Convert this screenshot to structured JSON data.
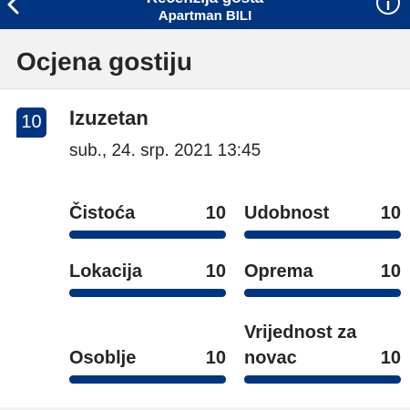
{
  "navbar": {
    "title": "Recenzija gosta",
    "subtitle": "Apartman BILI",
    "back_icon": "chevron-left-icon",
    "info_icon": "info-icon",
    "background": "#003580"
  },
  "section": {
    "title": "Ocjena gostiju"
  },
  "review": {
    "score": "10",
    "verdict": "Izuzetan",
    "date": "sub., 24. srp. 2021 13:45"
  },
  "categories": [
    {
      "label": "Čistoća",
      "score": "10",
      "fraction": 1.0
    },
    {
      "label": "Udobnost",
      "score": "10",
      "fraction": 1.0
    },
    {
      "label": "Lokacija",
      "score": "10",
      "fraction": 1.0
    },
    {
      "label": "Oprema",
      "score": "10",
      "fraction": 1.0
    },
    {
      "label": "Osoblje",
      "score": "10",
      "fraction": 1.0
    },
    {
      "label": "Vrijednost za novac",
      "score": "10",
      "fraction": 1.0
    }
  ],
  "colors": {
    "brand": "#003580",
    "header_bg": "#f2f2f2",
    "text": "#262626"
  }
}
